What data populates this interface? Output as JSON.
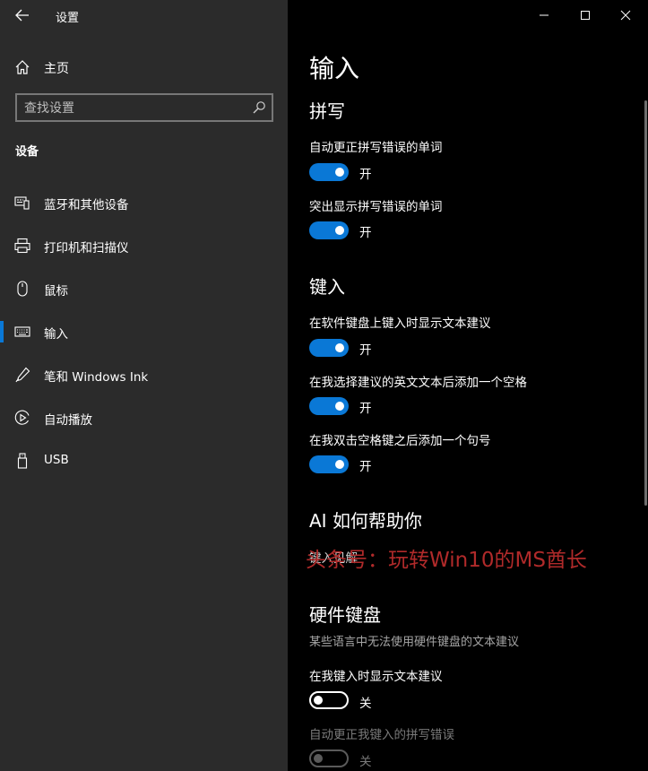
{
  "window": {
    "title": "设置",
    "controls": [
      "minimize-icon",
      "maximize-icon",
      "close-icon"
    ]
  },
  "sidebar": {
    "home_label": "主页",
    "search_placeholder": "查找设置",
    "section_title": "设备",
    "items": [
      {
        "label": "蓝牙和其他设备",
        "icon": "bluetooth-devices-icon"
      },
      {
        "label": "打印机和扫描仪",
        "icon": "printer-icon"
      },
      {
        "label": "鼠标",
        "icon": "mouse-icon"
      },
      {
        "label": "输入",
        "icon": "keyboard-icon",
        "selected": true
      },
      {
        "label": "笔和 Windows Ink",
        "icon": "pen-icon"
      },
      {
        "label": "自动播放",
        "icon": "autoplay-icon"
      },
      {
        "label": "USB",
        "icon": "usb-icon"
      }
    ]
  },
  "main": {
    "page_title": "输入",
    "spelling": {
      "heading": "拼写",
      "options": [
        {
          "label": "自动更正拼写错误的单词",
          "state": "开",
          "on": true
        },
        {
          "label": "突出显示拼写错误的单词",
          "state": "开",
          "on": true
        }
      ]
    },
    "typing": {
      "heading": "键入",
      "options": [
        {
          "label": "在软件键盘上键入时显示文本建议",
          "state": "开",
          "on": true
        },
        {
          "label": "在我选择建议的英文文本后添加一个空格",
          "state": "开",
          "on": true
        },
        {
          "label": "在我双击空格键之后添加一个句号",
          "state": "开",
          "on": true
        }
      ]
    },
    "ai": {
      "heading": "AI 如何帮助你",
      "link": "键入见解"
    },
    "hardware": {
      "heading": "硬件键盘",
      "description": "某些语言中无法使用硬件键盘的文本建议",
      "options": [
        {
          "label": "在我键入时显示文本建议",
          "state": "关",
          "on": false,
          "enabled": true
        },
        {
          "label": "自动更正我键入的拼写错误",
          "state": "关",
          "on": false,
          "enabled": false
        }
      ]
    },
    "watermark": "头条号：玩转Win10的MS酋长"
  },
  "colors": {
    "accent": "#0a78d6",
    "sidebar_bg": "#2b2b2b",
    "main_bg": "#000000",
    "watermark": "#b02a2a"
  }
}
